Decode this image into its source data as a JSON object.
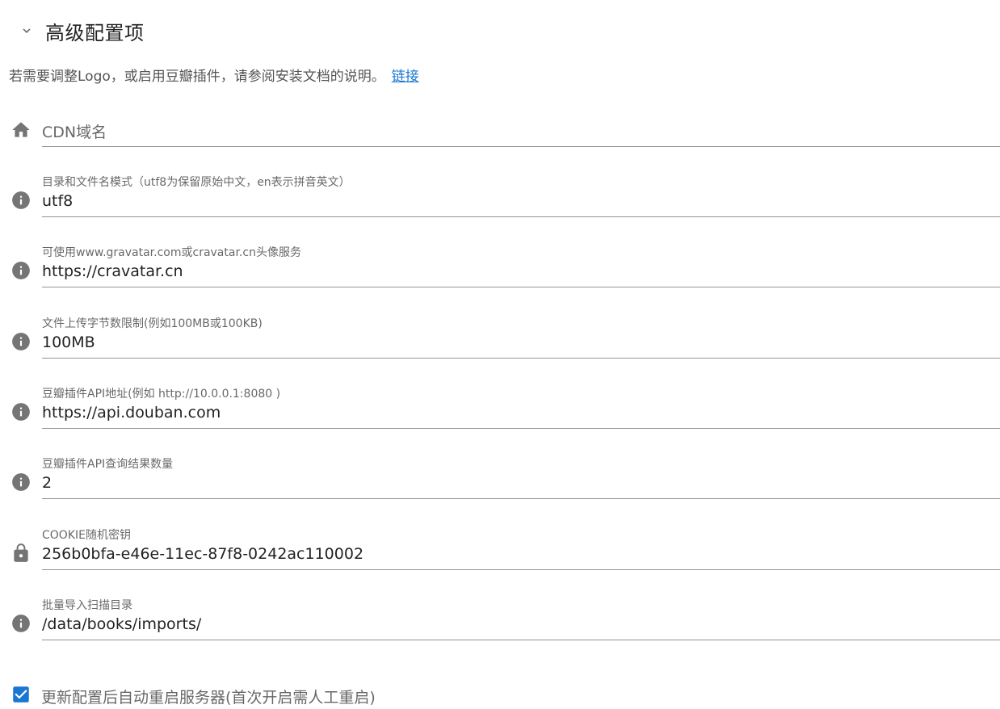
{
  "panel": {
    "title": "高级配置项",
    "hint_text": "若需要调整Logo，或启用豆瓣插件，请参阅安装文档的说明。",
    "hint_link": "链接"
  },
  "fields": {
    "cdn": {
      "label": "CDN域名",
      "value": "",
      "icon": "home-icon"
    },
    "dir_mode": {
      "label": "目录和文件名模式（utf8为保留原始中文，en表示拼音英文）",
      "value": "utf8",
      "icon": "info-icon"
    },
    "avatar": {
      "label": "可使用www.gravatar.com或cravatar.cn头像服务",
      "value": "https://cravatar.cn",
      "icon": "info-icon"
    },
    "upload_limit": {
      "label": "文件上传字节数限制(例如100MB或100KB)",
      "value": "100MB",
      "icon": "info-icon"
    },
    "douban_api": {
      "label": "豆瓣插件API地址(例如 http://10.0.0.1:8080 )",
      "value": "https://api.douban.com",
      "icon": "info-icon"
    },
    "douban_count": {
      "label": "豆瓣插件API查询结果数量",
      "value": "2",
      "icon": "info-icon"
    },
    "cookie_secret": {
      "label": "COOKIE随机密钥",
      "value": "256b0bfa-e46e-11ec-87f8-0242ac110002",
      "icon": "lock-icon"
    },
    "import_dir": {
      "label": "批量导入扫描目录",
      "value": "/data/books/imports/",
      "icon": "info-icon"
    }
  },
  "auto_restart": {
    "label": "更新配置后自动重启服务器(首次开启需人工重启)",
    "checked": true
  },
  "colors": {
    "accent": "#1976d2",
    "icon": "#757575"
  }
}
